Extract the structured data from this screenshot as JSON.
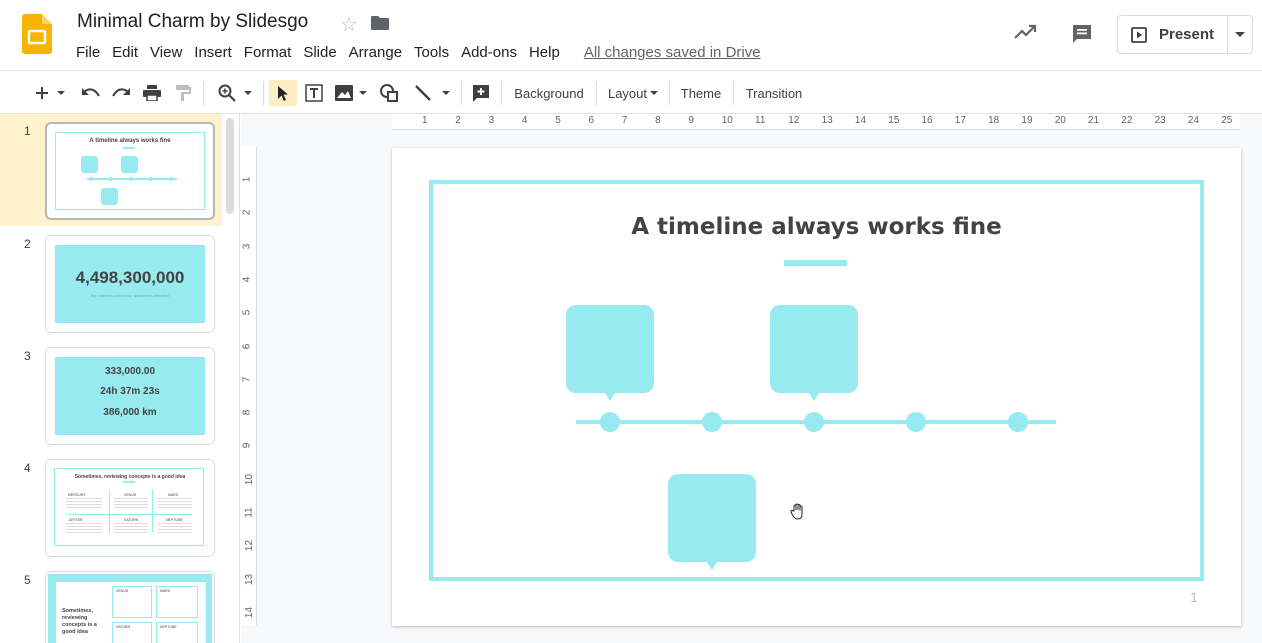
{
  "header": {
    "title": "Minimal Charm by Slidesgo",
    "menus": [
      "File",
      "Edit",
      "View",
      "Insert",
      "Format",
      "Slide",
      "Arrange",
      "Tools",
      "Add-ons",
      "Help"
    ],
    "saved_status": "All changes saved in Drive",
    "present_label": "Present",
    "icons": [
      "slides-logo-icon",
      "star-icon",
      "folder-icon",
      "trending-icon",
      "comment-icon",
      "present-icon",
      "caret-down-icon"
    ]
  },
  "toolbar": {
    "background_label": "Background",
    "layout_label": "Layout",
    "theme_label": "Theme",
    "transition_label": "Transition",
    "icons": [
      "plus-icon",
      "undo-icon",
      "redo-icon",
      "print-icon",
      "paint-format-icon",
      "zoom-icon",
      "select-cursor-icon",
      "text-box-icon",
      "image-icon",
      "shape-icon",
      "line-icon",
      "add-comment-icon"
    ]
  },
  "filmstrip": {
    "slides": [
      {
        "num": "1",
        "title": "A timeline always works fine"
      },
      {
        "num": "2",
        "big": "4,498,300,000",
        "caption": "Big numbers catch your audience's attention"
      },
      {
        "num": "3",
        "lines": [
          "333,000.00",
          "24h 37m 23s",
          "386,000 km"
        ]
      },
      {
        "num": "4",
        "title": "Sometimes, reviewing concepts is a good idea",
        "labels": [
          "MERCURY",
          "VENUS",
          "MARS",
          "JUPITER",
          "SATURN",
          "NEPTUNE"
        ]
      },
      {
        "num": "5",
        "title": "Sometimes, reviewing concepts is a good idea",
        "labels": [
          "VENUS",
          "MARS",
          "SATURN",
          "NEPTUNE"
        ]
      }
    ]
  },
  "ruler": {
    "top": [
      "1",
      "2",
      "3",
      "4",
      "5",
      "6",
      "7",
      "8",
      "9",
      "10",
      "11",
      "12",
      "13",
      "14",
      "15",
      "16",
      "17",
      "18",
      "19",
      "20",
      "21",
      "22",
      "23",
      "24",
      "25"
    ],
    "left": [
      "1",
      "2",
      "3",
      "4",
      "5",
      "6",
      "7",
      "8",
      "9",
      "10",
      "11",
      "12",
      "13",
      "14"
    ]
  },
  "slide": {
    "title": "A timeline always works fine",
    "page_number": "1",
    "accent_color": "#97eaef"
  }
}
